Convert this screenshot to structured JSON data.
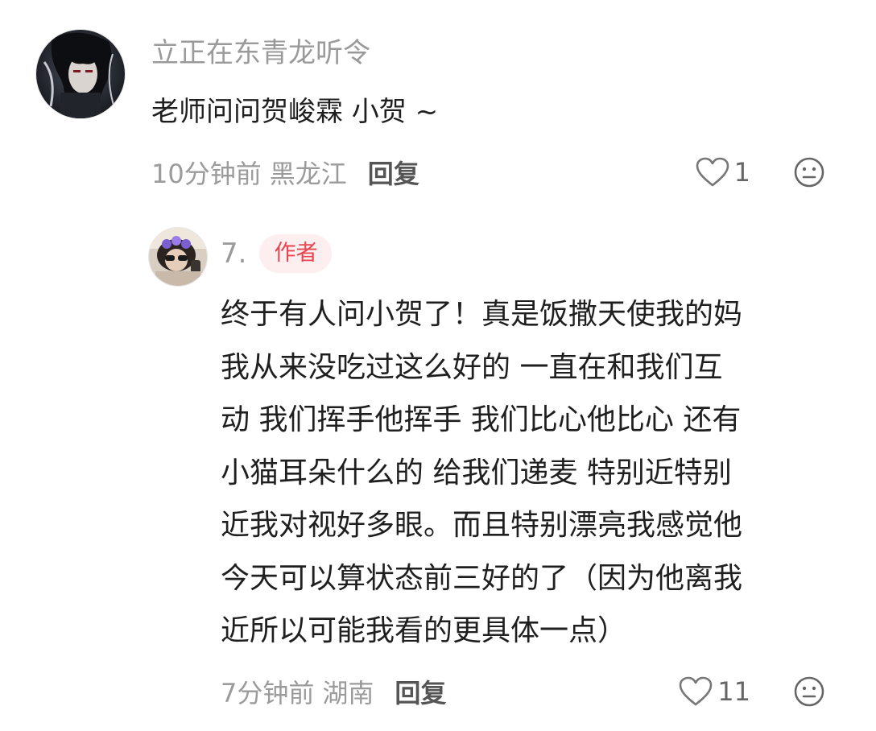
{
  "comments": [
    {
      "username": "立正在东青龙听令",
      "content": "老师问问贺峻霖 小贺 ~",
      "time": "10分钟前",
      "location": "黑龙江",
      "reply_label": "回复",
      "likes": "1"
    }
  ],
  "reply": {
    "username": "7.",
    "badge": "作者",
    "content_lines": [
      "终于有人问小贺了！真是饭撒天使我的妈",
      "我从来没吃过这么好的  一直在和我们互",
      "动 我们挥手他挥手 我们比心他比心 还有",
      "小猫耳朵什么的 给我们递麦 特别近特别",
      "近我对视好多眼。而且特别漂亮我感觉他",
      "今天可以算状态前三好的了（因为他离我",
      "近所以可能我看的更具体一点）"
    ],
    "time": "7分钟前",
    "location": "湖南",
    "reply_label": "回复",
    "likes": "11"
  },
  "colors": {
    "username": "#9a9a9a",
    "meta": "#9b9b9b",
    "badge_text": "#e8454f",
    "badge_bg": "#fdeef0"
  },
  "icons": [
    "heart-outline-icon",
    "dislike-face-icon"
  ]
}
